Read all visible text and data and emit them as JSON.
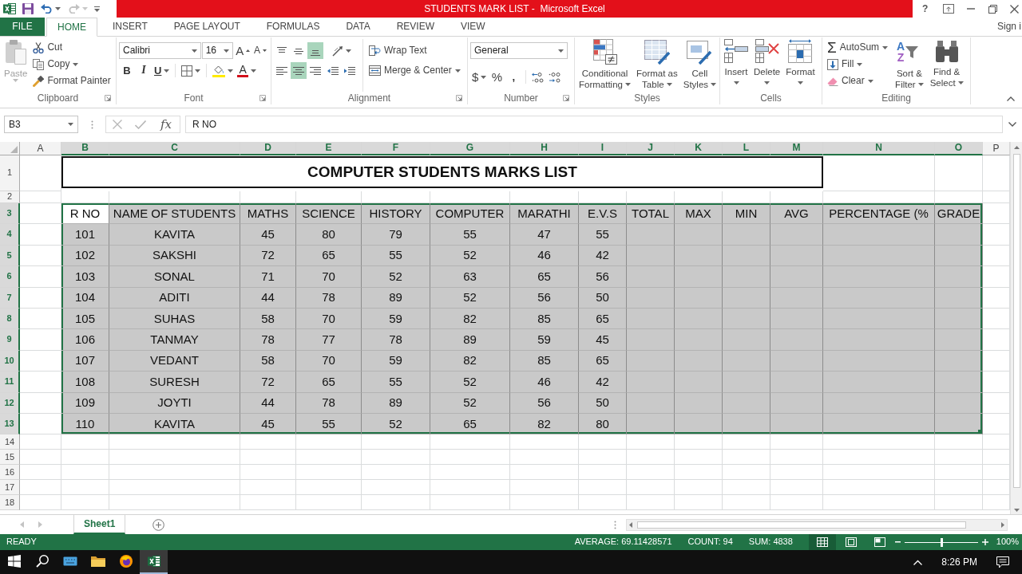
{
  "title_bar": {
    "title": "STUDENTS MARK LIST -  Microsoft Excel",
    "help": "?"
  },
  "quick_access": [
    {
      "kind": "save",
      "disabled": false
    },
    {
      "kind": "undo",
      "disabled": false
    },
    {
      "kind": "redo",
      "disabled": true
    }
  ],
  "ribbon_tabs": [
    {
      "label": "FILE",
      "kind": "backstage",
      "selected": false
    },
    {
      "label": "HOME",
      "kind": "tab",
      "selected": true
    },
    {
      "label": "INSERT",
      "kind": "tab",
      "selected": false
    },
    {
      "label": "PAGE LAYOUT",
      "kind": "tab",
      "selected": false
    },
    {
      "label": "FORMULAS",
      "kind": "tab",
      "selected": false
    },
    {
      "label": "DATA",
      "kind": "tab",
      "selected": false
    },
    {
      "label": "REVIEW",
      "kind": "tab",
      "selected": false
    },
    {
      "label": "VIEW",
      "kind": "tab",
      "selected": false
    }
  ],
  "account": "Sign i",
  "ribbon": {
    "clipboard": {
      "label": "Clipboard",
      "paste": {
        "label": "Paste",
        "disabled": true
      },
      "cut": "Cut",
      "copy": "Copy",
      "format_painter": "Format Painter"
    },
    "font": {
      "label": "Font",
      "font_name": "Calibri",
      "font_size": "16",
      "grow_font": "A",
      "shrink_font": "A",
      "bold": "B",
      "italic": "I",
      "underline": "U",
      "font_color": "A"
    },
    "alignment": {
      "label": "Alignment",
      "vertical": [
        {
          "kind": "top",
          "selected": false
        },
        {
          "kind": "middle",
          "selected": false
        },
        {
          "kind": "bottom",
          "selected": true
        }
      ],
      "horizontal": [
        {
          "kind": "left",
          "selected": false
        },
        {
          "kind": "center",
          "selected": true
        },
        {
          "kind": "right",
          "selected": false
        }
      ],
      "wrap_text": "Wrap Text",
      "merge_center": "Merge & Center"
    },
    "number": {
      "label": "Number",
      "format": "General",
      "currency": "$",
      "percent": "%",
      "comma": ","
    },
    "styles": {
      "label": "Styles",
      "buttons": [
        {
          "kind": "conditional_formatting",
          "lines": [
            "Conditional",
            "Formatting"
          ]
        },
        {
          "kind": "format_as_table",
          "lines": [
            "Format as",
            "Table"
          ]
        },
        {
          "kind": "cell_styles",
          "lines": [
            "Cell",
            "Styles"
          ]
        }
      ]
    },
    "cells": {
      "label": "Cells",
      "buttons": [
        {
          "kind": "insert",
          "label": "Insert"
        },
        {
          "kind": "delete",
          "label": "Delete"
        },
        {
          "kind": "format",
          "label": "Format"
        }
      ]
    },
    "editing": {
      "label": "Editing",
      "autosum": {
        "symbol": "Σ",
        "label": "AutoSum"
      },
      "fill": "Fill",
      "clear": "Clear",
      "buttons": [
        {
          "kind": "sort_filter",
          "lines": [
            "Sort &",
            "Filter"
          ],
          "letters": [
            "A",
            "Z"
          ]
        },
        {
          "kind": "find_select",
          "lines": [
            "Find &",
            "Select"
          ]
        }
      ]
    }
  },
  "formula_bar": {
    "name_box": "B3",
    "function_label": "fx",
    "formula": "R NO"
  },
  "sheet": {
    "columns": [
      {
        "label": "A",
        "selected": false
      },
      {
        "label": "B",
        "selected": true
      },
      {
        "label": "C",
        "selected": true
      },
      {
        "label": "D",
        "selected": true
      },
      {
        "label": "E",
        "selected": true
      },
      {
        "label": "F",
        "selected": true
      },
      {
        "label": "G",
        "selected": true
      },
      {
        "label": "H",
        "selected": true
      },
      {
        "label": "I",
        "selected": true
      },
      {
        "label": "J",
        "selected": true
      },
      {
        "label": "K",
        "selected": true
      },
      {
        "label": "L",
        "selected": true
      },
      {
        "label": "M",
        "selected": true
      },
      {
        "label": "N",
        "selected": true
      },
      {
        "label": "O",
        "selected": true
      },
      {
        "label": "P",
        "selected": false
      }
    ],
    "rows": [
      {
        "header": "1",
        "kind": "title",
        "selected": false,
        "title": "COMPUTER STUDENTS MARKS LIST"
      },
      {
        "header": "2",
        "kind": "gap",
        "selected": false
      },
      {
        "header": "3",
        "kind": "table",
        "selected": true,
        "cells": [
          "R NO",
          "NAME OF STUDENTS",
          "MATHS",
          "SCIENCE",
          "HISTORY",
          "COMPUTER",
          "MARATHI",
          "E.V.S",
          "TOTAL",
          "MAX",
          "MIN",
          "AVG",
          "PERCENTAGE (%",
          "GRADE"
        ]
      },
      {
        "header": "4",
        "kind": "table",
        "selected": true,
        "cells": [
          "101",
          "KAVITA",
          "45",
          "80",
          "79",
          "55",
          "47",
          "55"
        ]
      },
      {
        "header": "5",
        "kind": "table",
        "selected": true,
        "cells": [
          "102",
          "SAKSHI",
          "72",
          "65",
          "55",
          "52",
          "46",
          "42"
        ]
      },
      {
        "header": "6",
        "kind": "table",
        "selected": true,
        "cells": [
          "103",
          "SONAL",
          "71",
          "70",
          "52",
          "63",
          "65",
          "56"
        ]
      },
      {
        "header": "7",
        "kind": "table",
        "selected": true,
        "cells": [
          "104",
          "ADITI",
          "44",
          "78",
          "89",
          "52",
          "56",
          "50"
        ]
      },
      {
        "header": "8",
        "kind": "table",
        "selected": true,
        "cells": [
          "105",
          "SUHAS",
          "58",
          "70",
          "59",
          "82",
          "85",
          "65"
        ]
      },
      {
        "header": "9",
        "kind": "table",
        "selected": true,
        "cells": [
          "106",
          "TANMAY",
          "78",
          "77",
          "78",
          "89",
          "59",
          "45"
        ]
      },
      {
        "header": "10",
        "kind": "table",
        "selected": true,
        "cells": [
          "107",
          "VEDANT",
          "58",
          "70",
          "59",
          "82",
          "85",
          "65"
        ]
      },
      {
        "header": "11",
        "kind": "table",
        "selected": true,
        "cells": [
          "108",
          "SURESH",
          "72",
          "65",
          "55",
          "52",
          "46",
          "42"
        ]
      },
      {
        "header": "12",
        "kind": "table",
        "selected": true,
        "cells": [
          "109",
          "JOYTI",
          "44",
          "78",
          "89",
          "52",
          "56",
          "50"
        ]
      },
      {
        "header": "13",
        "kind": "table",
        "selected": true,
        "cells": [
          "110",
          "KAVITA",
          "45",
          "55",
          "52",
          "65",
          "82",
          "80"
        ]
      },
      {
        "header": "14",
        "kind": "blank",
        "selected": false
      },
      {
        "header": "15",
        "kind": "blank",
        "selected": false
      },
      {
        "header": "16",
        "kind": "blank",
        "selected": false
      },
      {
        "header": "17",
        "kind": "blank",
        "selected": false
      },
      {
        "header": "18",
        "kind": "blank",
        "selected": false
      }
    ]
  },
  "sheet_tabs": {
    "nav": [
      {
        "kind": "previous",
        "disabled": true
      },
      {
        "kind": "next",
        "disabled": true
      }
    ],
    "tabs": [
      {
        "label": "Sheet1",
        "selected": true
      }
    ]
  },
  "status_bar": {
    "mode": "READY",
    "stats": [
      "AVERAGE: 69.11428571",
      "COUNT: 94",
      "SUM: 4838"
    ],
    "views": [
      {
        "kind": "normal",
        "selected": true
      },
      {
        "kind": "page_layout",
        "selected": false
      },
      {
        "kind": "page_break_preview",
        "selected": false
      }
    ],
    "zoom": {
      "level": 0.5,
      "reading": "100%"
    }
  },
  "taskbar": {
    "apps": [
      {
        "kind": "start",
        "selected": false
      },
      {
        "kind": "search",
        "selected": false
      },
      {
        "kind": "keyboard",
        "selected": false
      },
      {
        "kind": "file_explorer",
        "selected": false
      },
      {
        "kind": "browser",
        "selected": false
      },
      {
        "kind": "spreadsheet",
        "selected": true
      }
    ],
    "clock": "8:26 PM"
  }
}
